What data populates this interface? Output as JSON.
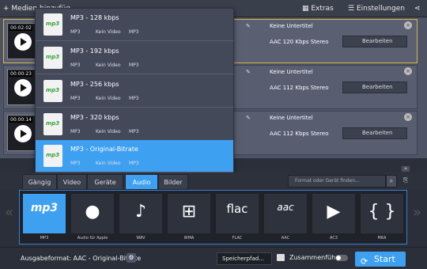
{
  "topbar": {
    "media_label": "Medien hinzufüg",
    "extras_label": "Extras",
    "settings_label": "Einstellungen"
  },
  "files": [
    {
      "time": "00:02:02",
      "subtitle": "Keine Untertitel",
      "audio": "AAC 120 Kbps Stereo",
      "edit": "Bearbeiten"
    },
    {
      "time": "00:00:23",
      "subtitle": "Keine Untertitel",
      "audio": "AAC 112 Kbps Stereo",
      "edit": "Bearbeiten"
    },
    {
      "time": "00:00:14",
      "subtitle": "Keine Untertitel",
      "audio": "AAC 112 Kbps Stereo",
      "edit": "Bearbeiten"
    }
  ],
  "dropdown": [
    {
      "name": "MP3 - 128 kbps",
      "a": "MP3",
      "b": "Kein Video",
      "c": "MP3"
    },
    {
      "name": "MP3 - 192 kbps",
      "a": "MP3",
      "b": "Kein Video",
      "c": "MP3"
    },
    {
      "name": "MP3 - 256 kbps",
      "a": "MP3",
      "b": "Kein Video",
      "c": "MP3"
    },
    {
      "name": "MP3 - 320 kbps",
      "a": "MP3",
      "b": "Kein Video",
      "c": "MP3"
    },
    {
      "name": "MP3 - Original-Bitrate",
      "a": "MP3",
      "b": "Kein Video",
      "c": "MP3"
    }
  ],
  "tabs": [
    "Gängig",
    "Video",
    "Geräte",
    "Audio",
    "Bilder"
  ],
  "search_placeholder": "Format oder Gerät finden...",
  "formats": [
    {
      "label": "MP3",
      "glyph": "mp3"
    },
    {
      "label": "Audio für Apple",
      "glyph": ""
    },
    {
      "label": "WAV",
      "glyph": "♪"
    },
    {
      "label": "WMA",
      "glyph": "⊞"
    },
    {
      "label": "FLAC",
      "glyph": "flac"
    },
    {
      "label": "AAC",
      "glyph": "aac"
    },
    {
      "label": "AC3",
      "glyph": "▶"
    },
    {
      "label": "MKA",
      "glyph": "{ }"
    }
  ],
  "footer": {
    "output_format": "Ausgabeformat: AAC - Original-Bitrate",
    "save_path": "Speicherpfad...",
    "merge": "Zusammenführen",
    "start": "Start"
  },
  "colors": {
    "accent": "#3ea0f0",
    "selected_border": "#d8b54a"
  }
}
